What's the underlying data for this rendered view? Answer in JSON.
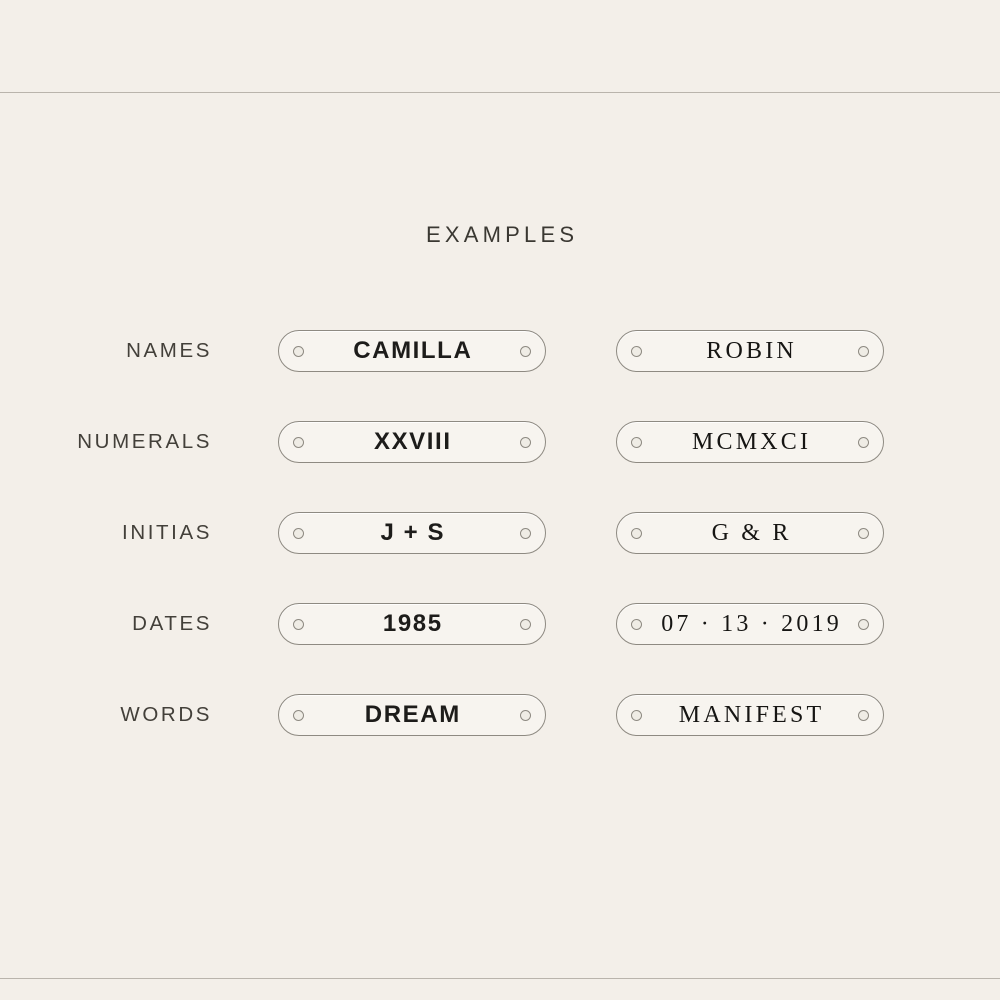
{
  "rules": {
    "color": "#b9b4ac"
  },
  "heading": {
    "title": "EXAMPLES"
  },
  "colors": {
    "background": "#f3efe9",
    "tag_fill": "#f7f4ef",
    "tag_border": "#8e8a82",
    "text": "#1d1c1a",
    "label_text": "#43403a"
  },
  "rows": [
    {
      "label": "NAMES",
      "left": {
        "text": "CAMILLA",
        "style": "sans"
      },
      "right": {
        "text": "ROBIN",
        "style": "serif"
      }
    },
    {
      "label": "NUMERALS",
      "left": {
        "text": "XXVIII",
        "style": "sans"
      },
      "right": {
        "text": "MCMXCI",
        "style": "serif"
      }
    },
    {
      "label": "INITIAS",
      "left": {
        "text": "J + S",
        "style": "sans"
      },
      "right": {
        "text": "G & R",
        "style": "serif"
      }
    },
    {
      "label": "DATES",
      "left": {
        "text": "1985",
        "style": "sans"
      },
      "right": {
        "text": "07 · 13 · 2019",
        "style": "serif"
      }
    },
    {
      "label": "WORDS",
      "left": {
        "text": "DREAM",
        "style": "sans"
      },
      "right": {
        "text": "MANIFEST",
        "style": "serif"
      }
    }
  ]
}
